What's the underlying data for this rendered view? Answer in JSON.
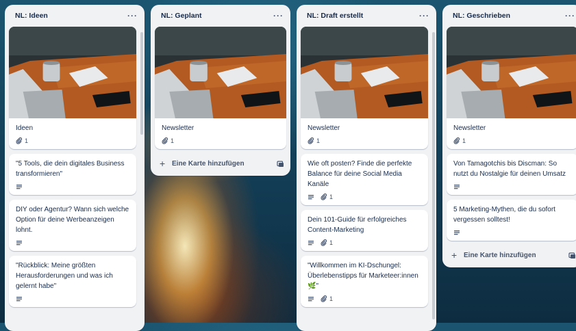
{
  "lists": [
    {
      "title": "NL: Ideen",
      "menu": "···",
      "cards": [
        {
          "title": "Ideen",
          "cover": true,
          "description": false,
          "attachments": "1"
        },
        {
          "title": "\"5 Tools, die dein digitales Business transformieren\"",
          "description": true
        },
        {
          "title": "DIY oder Agentur? Wann sich welche Option für deine Werbeanzeigen lohnt.",
          "description": true
        },
        {
          "title": "\"Rückblick: Meine größten Herausforderungen und was ich gelernt habe\"",
          "description": true
        }
      ]
    },
    {
      "title": "NL: Geplant",
      "menu": "···",
      "cards": [
        {
          "title": "Newsletter",
          "cover": true,
          "attachments": "1"
        }
      ],
      "add_card": "Eine Karte hinzufügen"
    },
    {
      "title": "NL: Draft erstellt",
      "menu": "···",
      "cards": [
        {
          "title": "Newsletter",
          "cover": true,
          "attachments": "1"
        },
        {
          "title": "Wie oft posten? Finde die perfekte Balance für deine Social Media Kanäle",
          "description": true,
          "attachments": "1"
        },
        {
          "title": "Dein 101-Guide für erfolgreiches Content-Marketing",
          "description": true,
          "attachments": "1"
        },
        {
          "title": "\"Willkommen im KI-Dschungel: Überlebenstipps für Marketeer:innen 🌿\"",
          "description": true,
          "attachments": "1"
        }
      ]
    },
    {
      "title": "NL: Geschrieben",
      "menu": "···",
      "cards": [
        {
          "title": "Newsletter",
          "cover": true,
          "attachments": "1"
        },
        {
          "title": "Von Tamagotchis bis Discman: So nutzt du Nostalgie für deinen Umsatz",
          "description": true
        },
        {
          "title": "5 Marketing-Mythen, die du sofort vergessen solltest!",
          "description": true
        }
      ],
      "add_card": "Eine Karte hinzufügen"
    }
  ],
  "icons": {
    "menu": "ellipsis-icon",
    "description": "description-icon",
    "attachment": "paperclip-icon",
    "add": "plus-icon",
    "template": "card-template-icon"
  }
}
